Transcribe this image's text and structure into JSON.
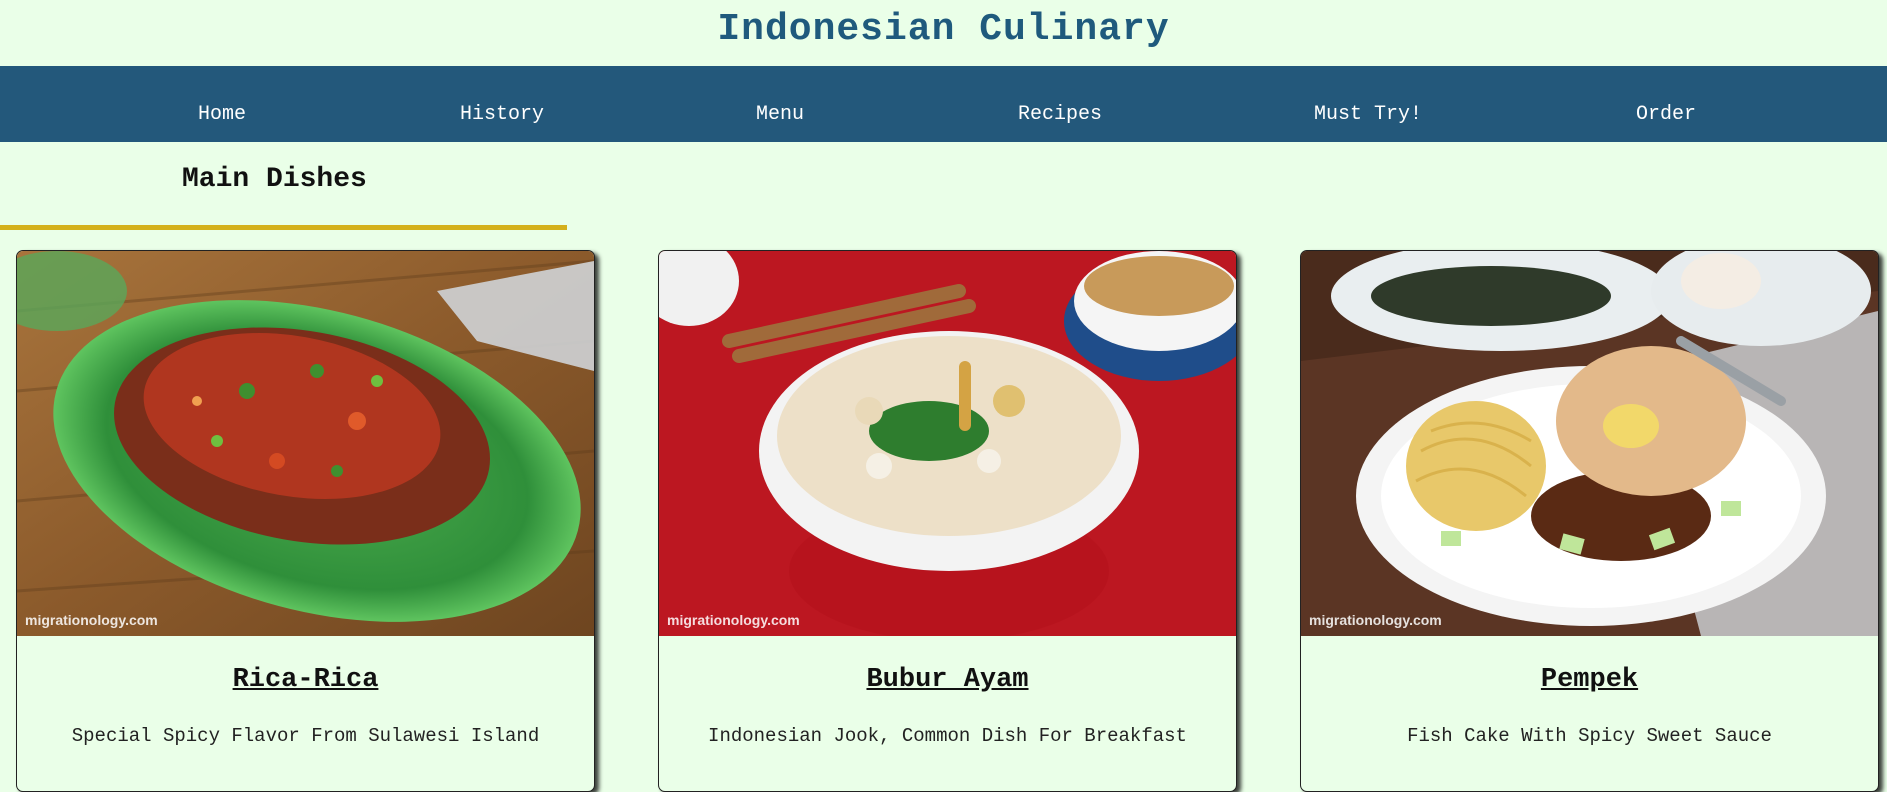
{
  "header": {
    "title": "Indonesian Culinary"
  },
  "nav": {
    "items": [
      {
        "label": "Home"
      },
      {
        "label": "History"
      },
      {
        "label": "Menu"
      },
      {
        "label": "Recipes"
      },
      {
        "label": "Must Try!"
      },
      {
        "label": "Order"
      }
    ]
  },
  "section": {
    "title": "Main Dishes"
  },
  "cards": [
    {
      "title": "Rica-Rica",
      "description": "Special Spicy Flavor From Sulawesi Island",
      "watermark": "migrationology.com"
    },
    {
      "title": "Bubur Ayam",
      "description": "Indonesian Jook, Common Dish For Breakfast",
      "watermark": "migrationology.com"
    },
    {
      "title": "Pempek",
      "description": "Fish Cake With Spicy Sweet Sauce",
      "watermark": "migrationology.com"
    }
  ],
  "colors": {
    "background": "#eaffe8",
    "nav": "#23587b",
    "title": "#1f5a7d",
    "accent_underline": "#d4b01b"
  }
}
